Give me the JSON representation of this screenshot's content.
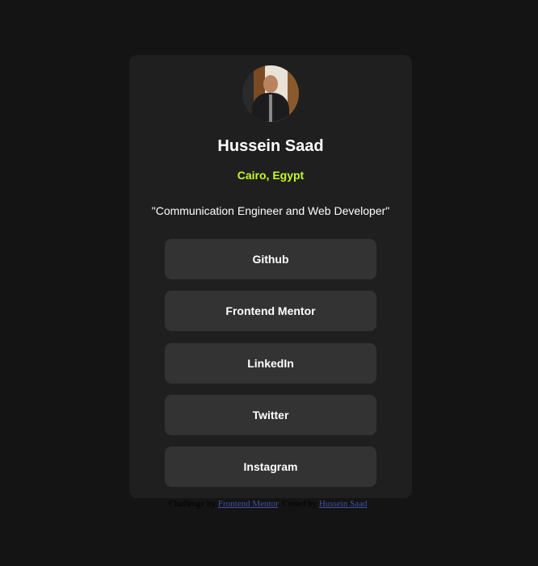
{
  "profile": {
    "name": "Hussein Saad",
    "location": "Cairo, Egypt",
    "bio": "\"Communication Engineer and Web Developer\""
  },
  "links": [
    {
      "label": "Github"
    },
    {
      "label": "Frontend Mentor"
    },
    {
      "label": "LinkedIn"
    },
    {
      "label": "Twitter"
    },
    {
      "label": "Instagram"
    }
  ],
  "attribution": {
    "prefix": "Challenge by",
    "link1": "Frontend Mentor",
    "middle": ". Coded by",
    "link2": "Hussein Saad",
    "suffix": "."
  },
  "colors": {
    "background": "#141414",
    "card": "#1f1f1f",
    "button": "#333333",
    "accent": "#c4f82a"
  }
}
